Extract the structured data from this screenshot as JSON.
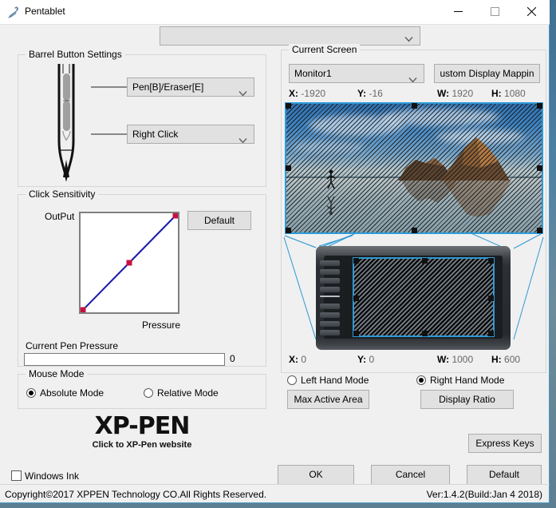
{
  "window": {
    "title": "Pentablet",
    "app_icon": "pen-icon",
    "controls": {
      "minimize": "minimize-icon",
      "maximize": "maximize-icon",
      "close": "close-icon"
    }
  },
  "top_selector": {
    "value": "",
    "placeholder": "",
    "icon": "chevron-down-icon"
  },
  "barrel": {
    "legend": "Barrel Button Settings",
    "button1": {
      "value": "Pen[B]/Eraser[E]"
    },
    "button2": {
      "value": "Right Click"
    }
  },
  "click_sensitivity": {
    "legend": "Click Sensitivity",
    "output_label": "OutPut",
    "pressure_label": "Pressure",
    "default_button": "Default",
    "curve_color": "#1a1aa8",
    "handle_color": "#c81040"
  },
  "chart_data": {
    "type": "line",
    "title": "Click Sensitivity",
    "xlabel": "Pressure",
    "ylabel": "OutPut",
    "xlim": [
      0,
      100
    ],
    "ylim": [
      0,
      100
    ],
    "grid": false,
    "points": [
      {
        "x": 0,
        "y": 0
      },
      {
        "x": 50,
        "y": 50
      },
      {
        "x": 100,
        "y": 100
      }
    ],
    "line_color": "#1a1aa8",
    "marker_color": "#c81040"
  },
  "pen_pressure": {
    "label": "Current Pen Pressure",
    "value": "0",
    "percent": 0
  },
  "mouse_mode": {
    "legend": "Mouse Mode",
    "options": [
      {
        "label": "Absolute Mode",
        "selected": true
      },
      {
        "label": "Relative Mode",
        "selected": false
      }
    ]
  },
  "current_screen": {
    "legend": "Current Screen",
    "monitor": {
      "value": "Monitor1"
    },
    "custom_mapping_button": "ustom Display Mappin",
    "coords": [
      {
        "key": "X:",
        "value": "-1920"
      },
      {
        "key": "Y:",
        "value": "-16"
      },
      {
        "key": "W:",
        "value": "1920"
      },
      {
        "key": "H:",
        "value": "1080"
      }
    ]
  },
  "tablet_area": {
    "coords": [
      {
        "key": "X:",
        "value": "0"
      },
      {
        "key": "Y:",
        "value": "0"
      },
      {
        "key": "W:",
        "value": "1000"
      },
      {
        "key": "H:",
        "value": "600"
      }
    ],
    "hand_modes": [
      {
        "label": "Left Hand Mode",
        "selected": false
      },
      {
        "label": "Right Hand Mode",
        "selected": true
      }
    ],
    "max_active_area_button": "Max Active Area",
    "display_ratio_button": "Display Ratio"
  },
  "branding": {
    "logo": "XP-PEN",
    "logo_sub": "Click to XP-Pen website"
  },
  "windows_ink": {
    "label": "Windows Ink",
    "checked": false
  },
  "footer": {
    "copyright": "Copyright©2017 XPPEN Technology CO.All Rights Reserved.",
    "version": "Ver:1.4.2(Build:Jan  4 2018)",
    "express_keys_button": "Express Keys",
    "ok_button": "OK",
    "cancel_button": "Cancel",
    "default_button": "Default"
  }
}
